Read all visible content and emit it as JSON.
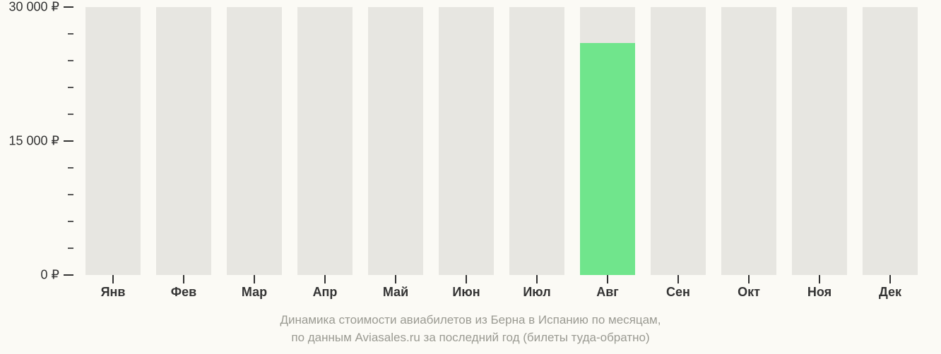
{
  "chart_data": {
    "type": "bar",
    "categories": [
      "Янв",
      "Фев",
      "Мар",
      "Апр",
      "Май",
      "Июн",
      "Июл",
      "Авг",
      "Сен",
      "Окт",
      "Ноя",
      "Дек"
    ],
    "values": [
      null,
      null,
      null,
      null,
      null,
      null,
      null,
      26000,
      null,
      null,
      null,
      null
    ],
    "ylim": [
      0,
      30000
    ],
    "y_major_ticks": [
      0,
      15000,
      30000
    ],
    "y_major_labels": [
      "0 ₽",
      "15 000 ₽",
      "30 000 ₽"
    ],
    "y_minor_step": 3000,
    "title_line1": "Динамика стоимости авиабилетов из Берна в Испанию по месяцам,",
    "title_line2": "по данным Aviasales.ru за последний год (билеты туда-обратно)",
    "bar_color": "#70e58c",
    "bar_bg_color": "#e7e6e1"
  }
}
